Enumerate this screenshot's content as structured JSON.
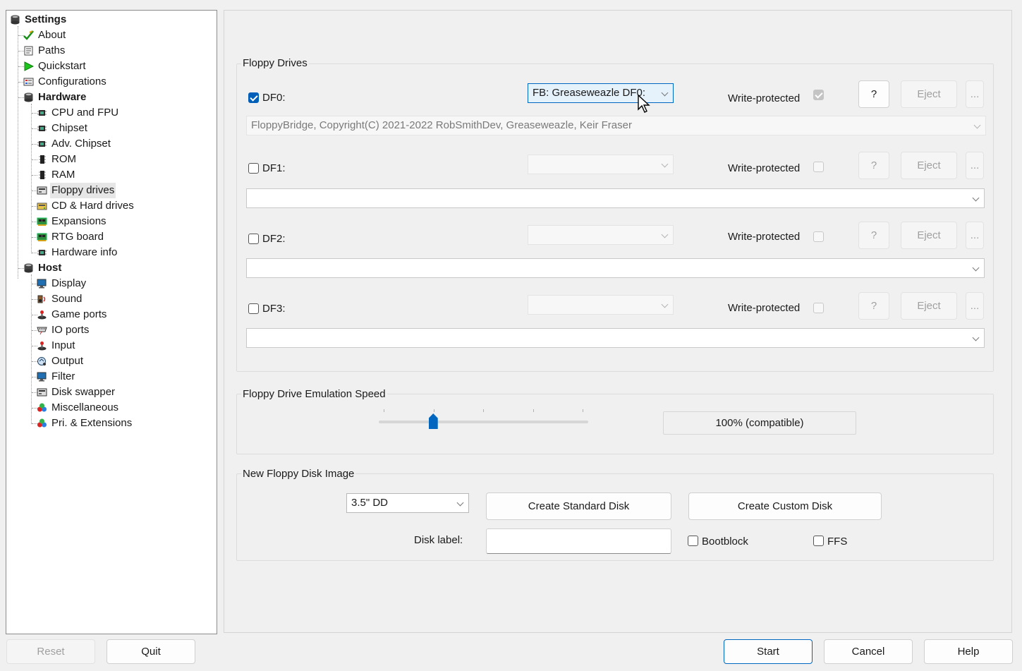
{
  "tree": {
    "items": [
      {
        "label": "Settings",
        "icon": "settings-icon"
      },
      {
        "label": "About",
        "icon": "about-icon"
      },
      {
        "label": "Paths",
        "icon": "paths-icon"
      },
      {
        "label": "Quickstart",
        "icon": "quickstart-icon"
      },
      {
        "label": "Configurations",
        "icon": "configurations-icon"
      },
      {
        "label": "Hardware",
        "icon": "hardware-icon"
      },
      {
        "label": "CPU and FPU",
        "icon": "chip-icon"
      },
      {
        "label": "Chipset",
        "icon": "chip-icon"
      },
      {
        "label": "Adv. Chipset",
        "icon": "chip-icon"
      },
      {
        "label": "ROM",
        "icon": "rom-icon"
      },
      {
        "label": "RAM",
        "icon": "ram-icon"
      },
      {
        "label": "Floppy drives",
        "icon": "floppy-drive-icon"
      },
      {
        "label": "CD & Hard drives",
        "icon": "hard-drive-icon"
      },
      {
        "label": "Expansions",
        "icon": "expansion-board-icon"
      },
      {
        "label": "RTG board",
        "icon": "expansion-board-icon"
      },
      {
        "label": "Hardware info",
        "icon": "chip-icon"
      },
      {
        "label": "Host",
        "icon": "host-icon"
      },
      {
        "label": "Display",
        "icon": "monitor-icon"
      },
      {
        "label": "Sound",
        "icon": "sound-icon"
      },
      {
        "label": "Game ports",
        "icon": "joystick-icon"
      },
      {
        "label": "IO ports",
        "icon": "io-port-icon"
      },
      {
        "label": "Input",
        "icon": "joystick-icon"
      },
      {
        "label": "Output",
        "icon": "output-icon"
      },
      {
        "label": "Filter",
        "icon": "monitor-icon"
      },
      {
        "label": "Disk swapper",
        "icon": "floppy-drive-icon"
      },
      {
        "label": "Miscellaneous",
        "icon": "misc-icon"
      },
      {
        "label": "Pri. & Extensions",
        "icon": "misc-icon"
      }
    ],
    "selected": "Floppy drives"
  },
  "floppy_drives": {
    "title": "Floppy Drives",
    "write_protected_label": "Write-protected",
    "help_label": "?",
    "eject_label": "Eject",
    "more_label": "...",
    "drives": [
      {
        "label": "DF0:",
        "enabled": true,
        "type": "FB: Greaseweazle DF0:",
        "path": "FloppyBridge, Copyright(C) 2021-2022 RobSmithDev, Greaseweazle, Keir Fraser",
        "write_protected": true
      },
      {
        "label": "DF1:",
        "enabled": false,
        "type": "",
        "path": "",
        "write_protected": false
      },
      {
        "label": "DF2:",
        "enabled": false,
        "type": "",
        "path": "",
        "write_protected": false
      },
      {
        "label": "DF3:",
        "enabled": false,
        "type": "",
        "path": "",
        "write_protected": false
      }
    ]
  },
  "emulation_speed": {
    "title": "Floppy Drive Emulation Speed",
    "value_label": "100% (compatible)",
    "slider_position_fraction": 0.26
  },
  "new_disk": {
    "title": "New Floppy Disk Image",
    "disk_type": "3.5\" DD",
    "create_standard_label": "Create Standard Disk",
    "create_custom_label": "Create Custom Disk",
    "disk_label_caption": "Disk label:",
    "disk_label_value": "",
    "bootblock_label": "Bootblock",
    "ffs_label": "FFS"
  },
  "footer": {
    "reset_label": "Reset",
    "quit_label": "Quit",
    "start_label": "Start",
    "cancel_label": "Cancel",
    "help_label": "Help"
  },
  "colors": {
    "accent": "#0067c0",
    "checkbox_checked": "#005fb8"
  }
}
